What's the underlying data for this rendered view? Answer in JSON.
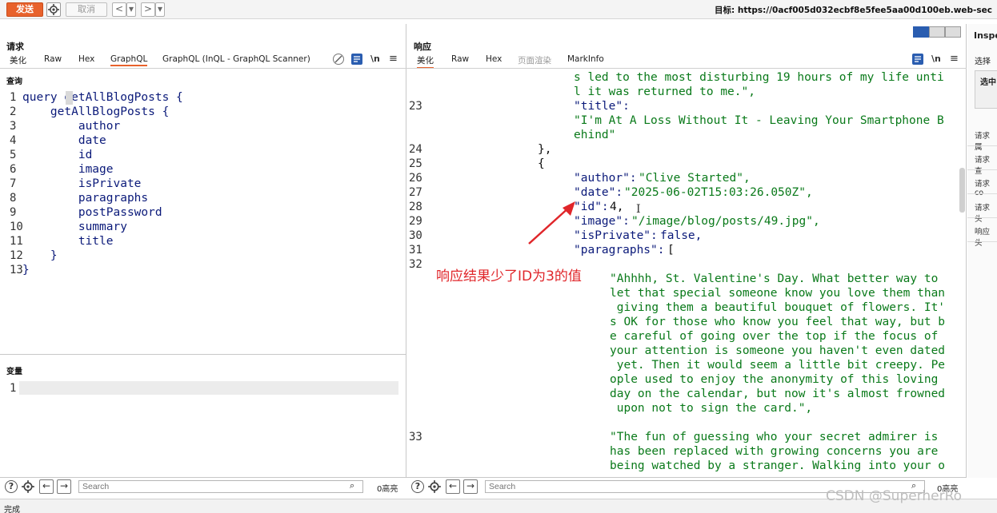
{
  "toolbar": {
    "send_label": "发送",
    "cancel_label": "取消",
    "back_label": "<",
    "fwd_label": ">",
    "dropdown_label": "▾",
    "target_text": "目标: https://0acf005d032ecbf8e5fee5aa00d100eb.web-sec"
  },
  "request": {
    "title": "请求",
    "tabs": [
      "美化",
      "Raw",
      "Hex",
      "GraphQL",
      "GraphQL (InQL - GraphQL Scanner)"
    ],
    "active_tab": "GraphQL",
    "query_label": "查询",
    "query_lines": [
      "query getAllBlogPosts {",
      "    getAllBlogPosts {",
      "        author",
      "        date",
      "        id",
      "        image",
      "        isPrivate",
      "        paragraphs",
      "        postPassword",
      "        summary",
      "        title",
      "    }",
      "}"
    ],
    "variables_label": "变量",
    "search_placeholder": "Search",
    "highlight_count": "0高亮"
  },
  "response": {
    "title": "响应",
    "tabs": [
      "美化",
      "Raw",
      "Hex",
      "页面渲染",
      "MarkInfo"
    ],
    "active_tab": "美化",
    "line_numbers": [
      "23",
      "24",
      "25",
      "26",
      "27",
      "28",
      "29",
      "30",
      "31",
      "32",
      "33"
    ],
    "code": {
      "l0a": "s led to the most disturbing 19 hours of my life unti",
      "l0b": "l it was returned to me.\",",
      "title_key": "\"title\":",
      "title_val1": "\"I'm At A Loss Without It - Leaving Your Smartphone B",
      "title_val2": "ehind\"",
      "close_brace": "},",
      "open_brace": "{",
      "author_key": "\"author\":",
      "author_val": "\"Clive Started\",",
      "date_key": "\"date\":",
      "date_val": "\"2025-06-02T15:03:26.050Z\",",
      "id_key": "\"id\":",
      "id_val": "4,",
      "image_key": "\"image\":",
      "image_val": "\"/image/blog/posts/49.jpg\",",
      "private_key": "\"isPrivate\":",
      "private_val": "false,",
      "para_key": "\"paragraphs\":",
      "para_open": "[",
      "p1": [
        "\"Ahhhh, St. Valentine's Day. What better way to",
        "let that special someone know you love them than",
        " giving them a beautiful bouquet of flowers. It'",
        "s OK for those who know you feel that way, but b",
        "e careful of going over the top if the focus of",
        "your attention is someone you haven't even dated",
        " yet. Then it would seem a little bit creepy. Pe",
        "ople used to enjoy the anonymity of this loving",
        "day on the calendar, but now it's almost frowned",
        " upon not to sign the card.\","
      ],
      "p2": [
        "\"The fun of guessing who your secret admirer is",
        "has been replaced with growing concerns you are",
        "being watched by a stranger. Walking into your o"
      ]
    },
    "annotation": "响应结果少了ID为3的值",
    "search_placeholder": "Search",
    "highlight_count": "0高亮"
  },
  "inspector": {
    "title": "Inspe",
    "select_label": "选择",
    "selected_label": "选中",
    "items": [
      "请求属",
      "请求查",
      "请求co",
      "请求头",
      "响应头"
    ]
  },
  "status": {
    "text": "完成",
    "watermark": "CSDN @SuperherRo"
  },
  "colors": {
    "accent": "#e8622c",
    "annotation": "#e0262a"
  }
}
